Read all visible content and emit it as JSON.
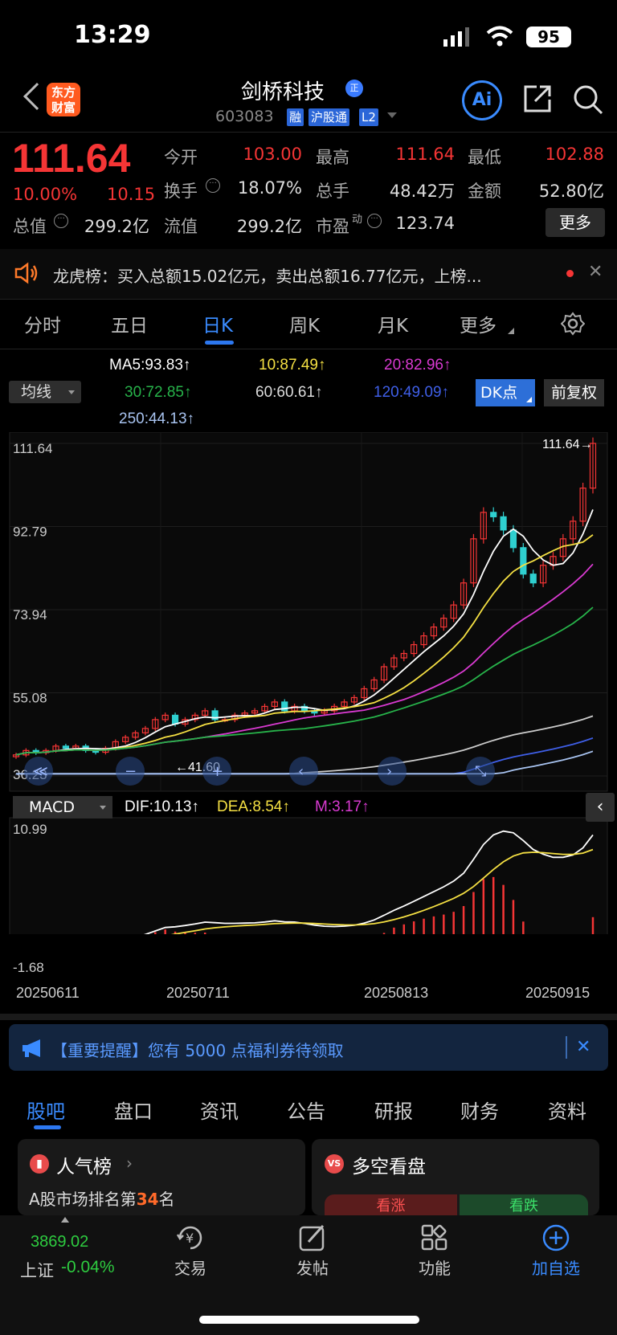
{
  "status": {
    "time": "13:29",
    "battery": "95"
  },
  "header": {
    "logo": "东方财富",
    "stock_name": "剑桥科技",
    "zheng_badge": "正",
    "code": "603083",
    "tags": [
      "融",
      "沪股通",
      "L2"
    ],
    "ai_label": "Ai"
  },
  "quote": {
    "price": "111.64",
    "change_pct": "10.00%",
    "change": "10.15",
    "open_label": "今开",
    "open": "103.00",
    "high_label": "最高",
    "high": "111.64",
    "low_label": "最低",
    "low": "102.88",
    "turnover_label": "换手",
    "turnover": "18.07%",
    "volume_label": "总手",
    "volume": "48.42万",
    "amount_label": "金额",
    "amount": "52.80亿",
    "mcap_label": "总值",
    "mcap": "299.2亿",
    "float_label": "流值",
    "float": "299.2亿",
    "pe_label": "市盈",
    "pe_sup": "动",
    "pe": "123.74",
    "more": "更多"
  },
  "lhb": {
    "text": "龙虎榜：买入总额15.02亿元，卖出总额16.77亿元，上榜..."
  },
  "ktabs": [
    "分时",
    "五日",
    "日K",
    "周K",
    "月K",
    "更多"
  ],
  "ma": {
    "selector": "均线",
    "ma5": "MA5:93.83↑",
    "ma10": "10:87.49↑",
    "ma20": "20:82.96↑",
    "ma30": "30:72.85↑",
    "ma60": "60:60.61↑",
    "ma120": "120:49.09↑",
    "ma250": "250:44.13↑",
    "dk": "DK点",
    "fq": "前复权"
  },
  "kchart": {
    "y_labels": [
      "111.64",
      "92.79",
      "73.94",
      "55.08",
      "36.23"
    ],
    "last_label": "111.64",
    "low_marker": "41.60"
  },
  "macd": {
    "selector": "MACD",
    "dif": "DIF:10.13↑",
    "dea": "DEA:8.54↑",
    "m": "M:3.17↑",
    "top": "10.99",
    "bottom": "-1.68"
  },
  "dates": [
    "20250611",
    "20250711",
    "20250813",
    "20250915"
  ],
  "notice": {
    "text": "【重要提醒】您有 5000 点福利券待领取"
  },
  "btabs": [
    "股吧",
    "盘口",
    "资讯",
    "公告",
    "研报",
    "财务",
    "资料"
  ],
  "cards": {
    "hot_title": "人气榜",
    "hot_sub_pre": "A股市场排名第",
    "hot_rank": "34",
    "hot_sub_post": "名",
    "ls_title": "多空看盘",
    "ls_up": "看涨",
    "ls_down": "看跌"
  },
  "nav": {
    "index_value": "3869.02",
    "index_name": "上证",
    "index_change": "-0.04%",
    "items": [
      "交易",
      "发帖",
      "功能",
      "加自选"
    ]
  },
  "chart_data": {
    "type": "candlestick",
    "price_axis": [
      36.23,
      111.64
    ],
    "closes": [
      41,
      42,
      41.5,
      42,
      43,
      42.5,
      43,
      42,
      41.6,
      42.5,
      44,
      45,
      46,
      47,
      49,
      50,
      48,
      49,
      50,
      51,
      49,
      49,
      50,
      50.5,
      51,
      52,
      53,
      51,
      52,
      51,
      50.5,
      51,
      52,
      53,
      54,
      56,
      58,
      61,
      63,
      64,
      66,
      68,
      70,
      72,
      75,
      80,
      90,
      96,
      95,
      92,
      88,
      82,
      80,
      84,
      86,
      90,
      94,
      101.5,
      111.64
    ],
    "macd_axis": [
      -1.68,
      10.99
    ]
  }
}
